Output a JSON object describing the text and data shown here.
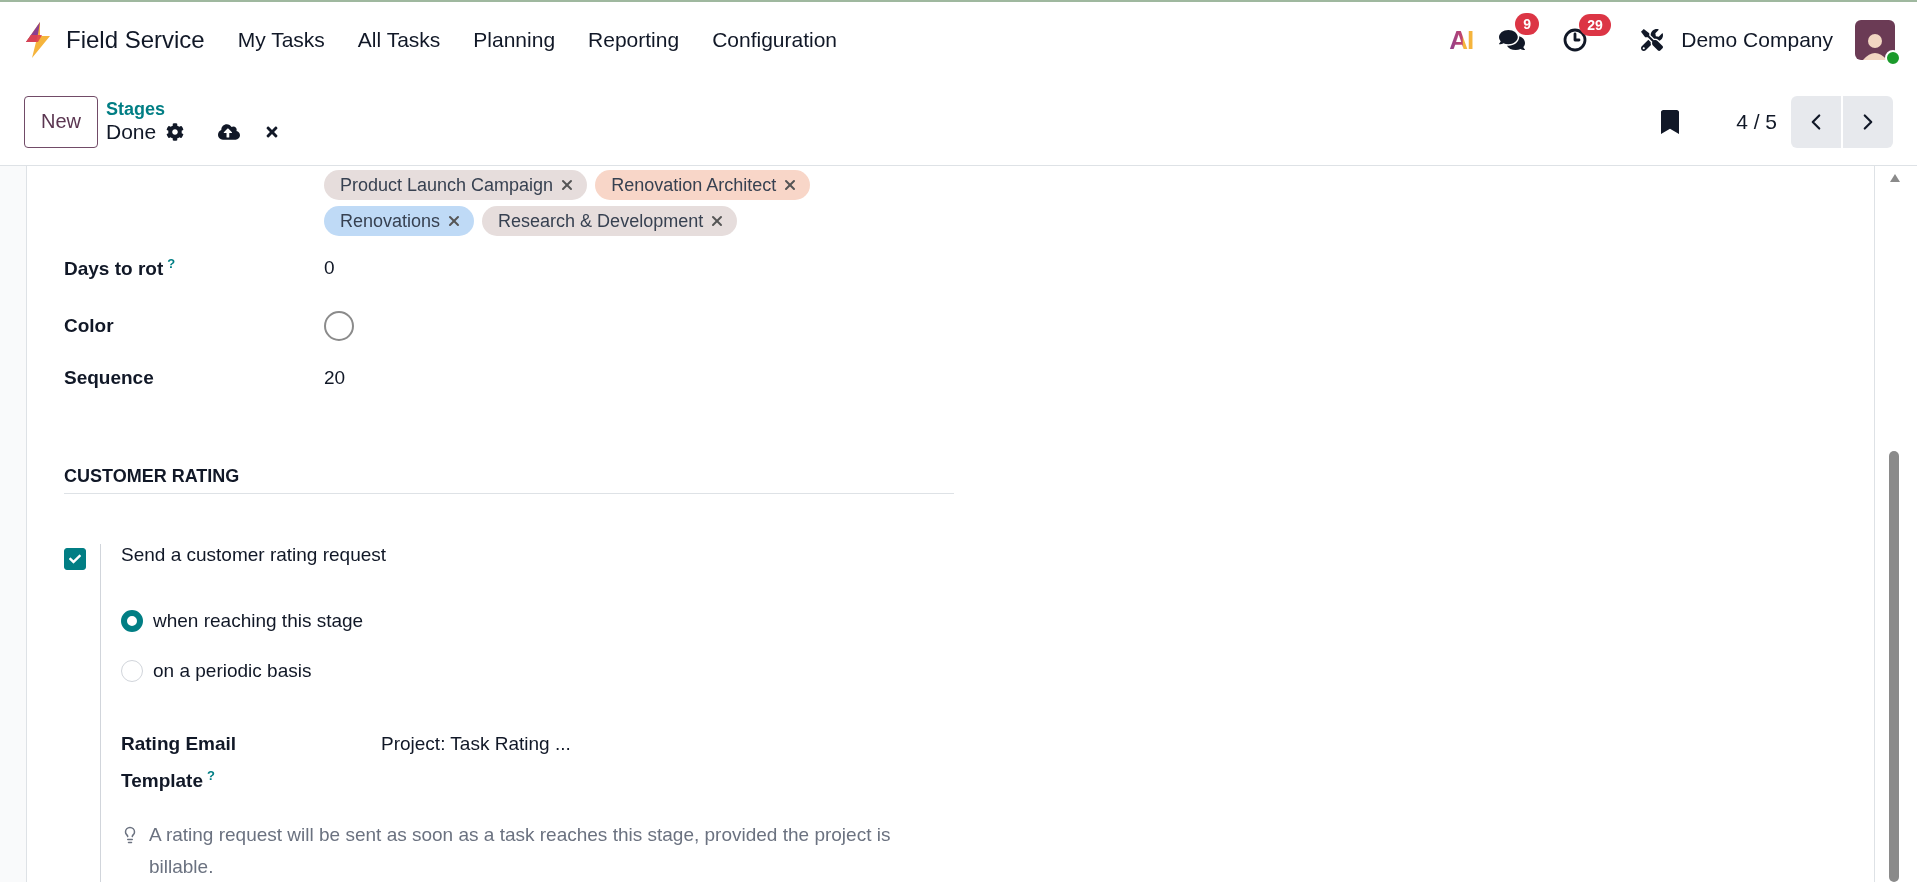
{
  "navbar": {
    "app_name": "Field Service",
    "menu": [
      "My Tasks",
      "All Tasks",
      "Planning",
      "Reporting",
      "Configuration"
    ],
    "ai_label": "AI",
    "messages_badge": "9",
    "activities_badge": "29",
    "company": "Demo Company",
    "avatar_online": true
  },
  "control_panel": {
    "new_button": "New",
    "breadcrumb": "Stages",
    "record_name": "Done",
    "pager": "4 / 5"
  },
  "form": {
    "tags": [
      {
        "label": "Product Launch Campaign",
        "color": "#e6dddc"
      },
      {
        "label": "Renovation Architect",
        "color": "#f8d6c8"
      },
      {
        "label": "Renovations",
        "color": "#bfdaf6"
      },
      {
        "label": "Research & Development",
        "color": "#e6dddc"
      }
    ],
    "fields": [
      {
        "label": "Days to rot",
        "help": "?",
        "kind": "text",
        "value": "0"
      },
      {
        "label": "Color",
        "kind": "color"
      },
      {
        "label": "Sequence",
        "kind": "text",
        "value": "20"
      }
    ],
    "section": {
      "title": "CUSTOMER RATING",
      "checkbox": {
        "label": "Send a customer rating request",
        "checked": true
      },
      "options": [
        {
          "label": "when reaching this stage",
          "selected": true
        },
        {
          "label": "on a periodic basis",
          "selected": false
        }
      ],
      "template": {
        "label_line1": "Rating Email",
        "label_line2": "Template",
        "help": "?",
        "value": "Project: Task Rating ..."
      },
      "hint": "A rating request will be sent as soon as a task reaches this stage, provided the project is billable."
    }
  }
}
